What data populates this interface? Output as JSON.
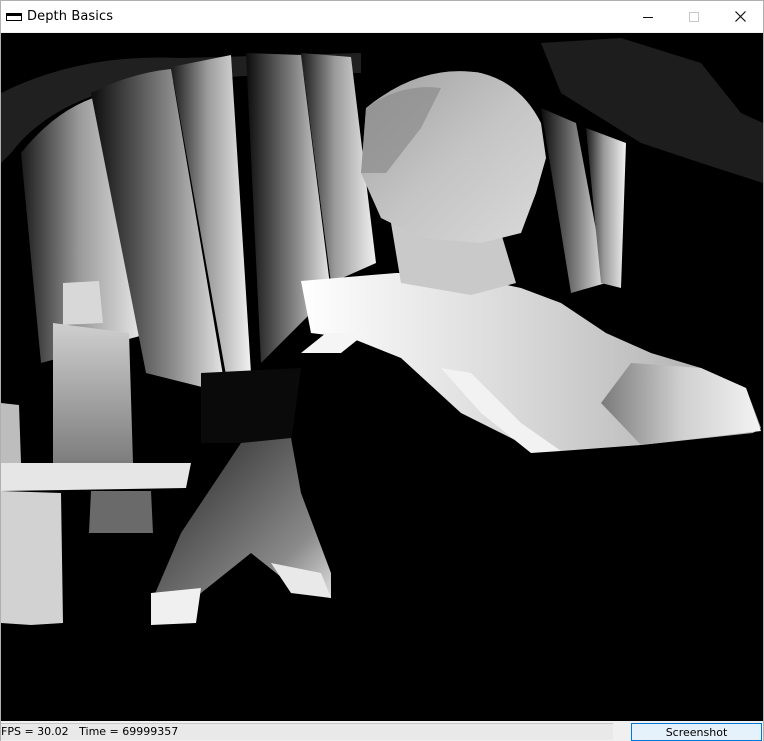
{
  "window": {
    "title": "Depth Basics",
    "icon": "app-window-icon"
  },
  "caption_buttons": {
    "minimize": "minimize-icon",
    "maximize": "maximize-icon",
    "close": "close-icon"
  },
  "viewport": {
    "content": "depth-image",
    "background_color": "#000000"
  },
  "status": {
    "text": "FPS = 30.02   Time = 69999357"
  },
  "buttons": {
    "screenshot_label": "Screenshot"
  },
  "colors": {
    "accent": "#0078d7",
    "button_fill": "#e5f1fb",
    "statusbar": "#e9e9e9"
  }
}
